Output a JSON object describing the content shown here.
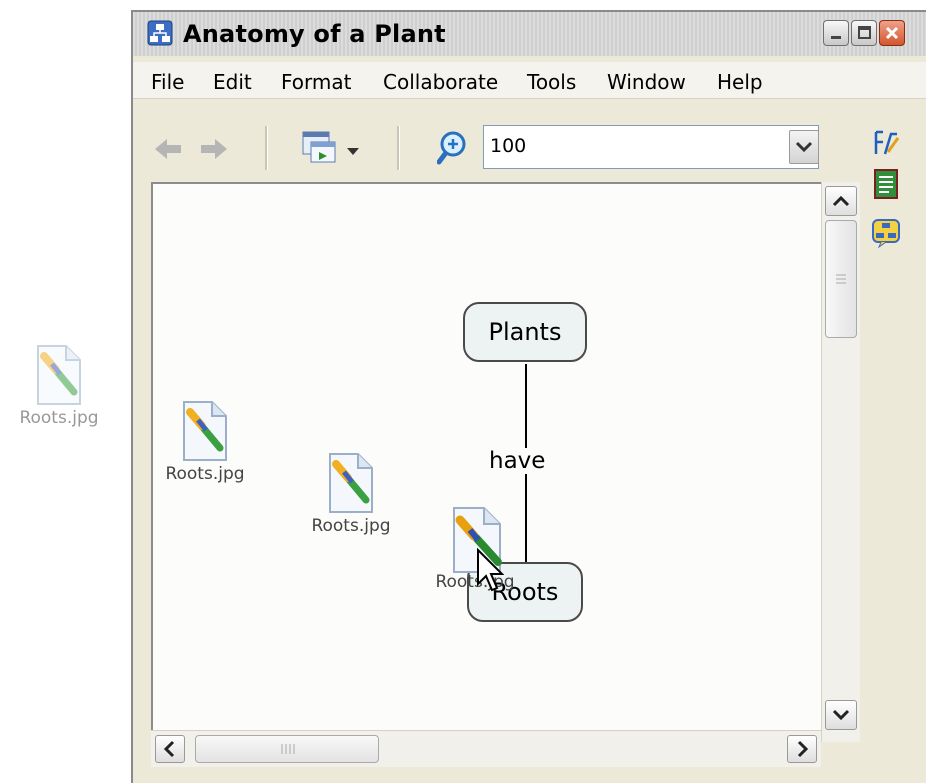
{
  "window": {
    "title": "Anatomy of a Plant",
    "controls": {
      "minimize": "minimize",
      "maximize": "maximize",
      "close": "close"
    }
  },
  "menu": [
    "File",
    "Edit",
    "Format",
    "Collaborate",
    "Tools",
    "Window",
    "Help"
  ],
  "toolbar": {
    "zoom_value": "100",
    "icons": [
      "back-arrow-icon",
      "forward-arrow-icon",
      "view-window-icon",
      "zoom-icon",
      "dropdown-arrow-icon"
    ]
  },
  "side_icons": [
    "styles-icon",
    "outline-icon",
    "cmap-view-icon"
  ],
  "concept_map": {
    "concepts": [
      "Plants",
      "Roots"
    ],
    "link_phrase": "have"
  },
  "dragged_files": [
    {
      "label": "Roots.jpg"
    },
    {
      "label": "Roots.jpg"
    },
    {
      "label": "Roots.jpg"
    },
    {
      "label": "Roots.jpg"
    }
  ],
  "colors": {
    "titlebar": "#d6d6d6",
    "close_button": "#d2562e",
    "concept_fill": "#edf2f2"
  }
}
